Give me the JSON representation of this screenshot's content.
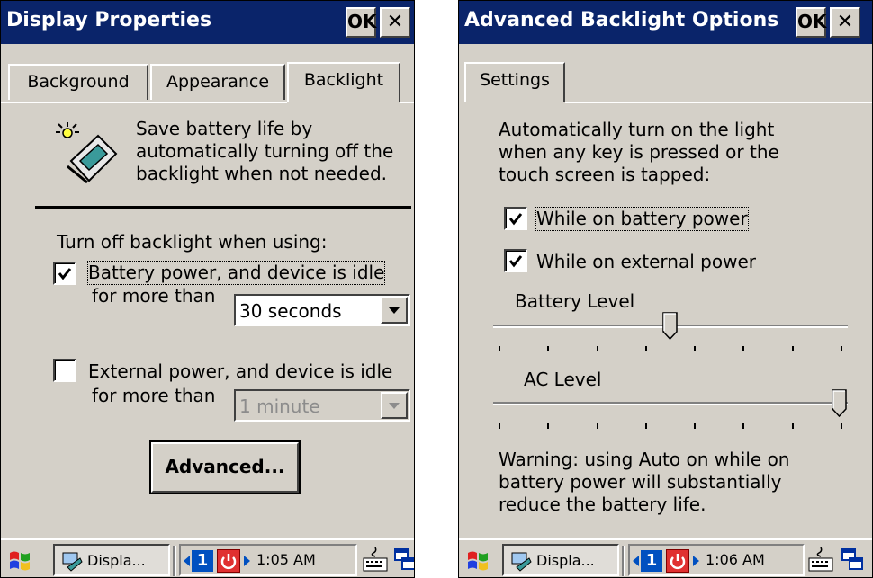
{
  "left_window": {
    "title": "Display Properties",
    "ok_label": "OK",
    "close_glyph": "✕",
    "tabs": [
      "Background",
      "Appearance",
      "Backlight"
    ],
    "active_tab": "Backlight",
    "description": "Save battery life by\nautomatically turning off the\nbacklight when not needed.",
    "section_label": "Turn off backlight when using:",
    "battery_option": {
      "label": "Battery power, and device is idle",
      "checked": true,
      "sublabel": "for more than",
      "value": "30 seconds"
    },
    "external_option": {
      "label": "External power, and device is idle",
      "checked": false,
      "sublabel": "for more than",
      "value": "1 minute",
      "disabled": true
    },
    "advanced_label": "Advanced..."
  },
  "right_window": {
    "title": "Advanced Backlight Options",
    "ok_label": "OK",
    "close_glyph": "✕",
    "tabs": [
      "Settings"
    ],
    "intro": "Automatically turn on the light\nwhen any key is pressed or the\ntouch screen is tapped:",
    "while_battery": {
      "label": "While on battery power",
      "checked": true
    },
    "while_external": {
      "label": "While on external power",
      "checked": true
    },
    "battery_level": {
      "label": "Battery Level",
      "fraction": 0.5
    },
    "ac_level": {
      "label": "AC Level",
      "fraction": 1.0
    },
    "warning": "Warning: using Auto on while on\nbattery power will substantially\nreduce the battery life."
  },
  "taskbar_left": {
    "task_label": "Displa...",
    "page_number": "1",
    "time": "1:05 AM"
  },
  "taskbar_right": {
    "task_label": "Displa...",
    "page_number": "1",
    "time": "1:06 AM"
  },
  "icons": [
    "windows-start-icon",
    "display-properties-icon",
    "power-icon",
    "keyboard-icon",
    "switch-windows-icon",
    "backlight-device-icon"
  ]
}
